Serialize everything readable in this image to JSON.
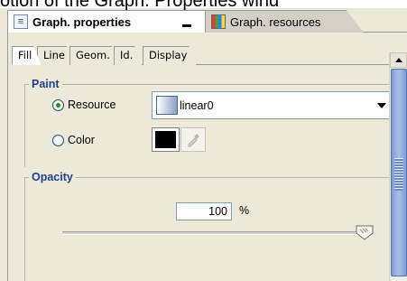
{
  "caption": {
    "text": "otion of the Graph. Properties wind"
  },
  "view_tabs": [
    {
      "label": "Graph. properties",
      "active": true,
      "icon": "properties-icon"
    },
    {
      "label": "Graph. resources",
      "active": false,
      "icon": "resources-icon"
    }
  ],
  "inner_tabs": [
    {
      "label": "Fill",
      "active": true
    },
    {
      "label": "Line",
      "active": false
    },
    {
      "label": "Geom.",
      "active": false
    },
    {
      "label": "Id.",
      "active": false
    },
    {
      "label": "Display",
      "active": false
    }
  ],
  "paint": {
    "title": "Paint",
    "resource_label": "Resource",
    "resource_checked": true,
    "resource_value": "linear0",
    "color_label": "Color",
    "color_checked": false,
    "color_value": "#000000"
  },
  "opacity": {
    "title": "Opacity",
    "value": "100",
    "unit": "%",
    "slider_fraction": 1.0
  },
  "colors": {
    "panel_bg": "#ece9d8",
    "group_title": "#1f3f8c",
    "scrollbar_thumb": "#8fb0e6"
  }
}
